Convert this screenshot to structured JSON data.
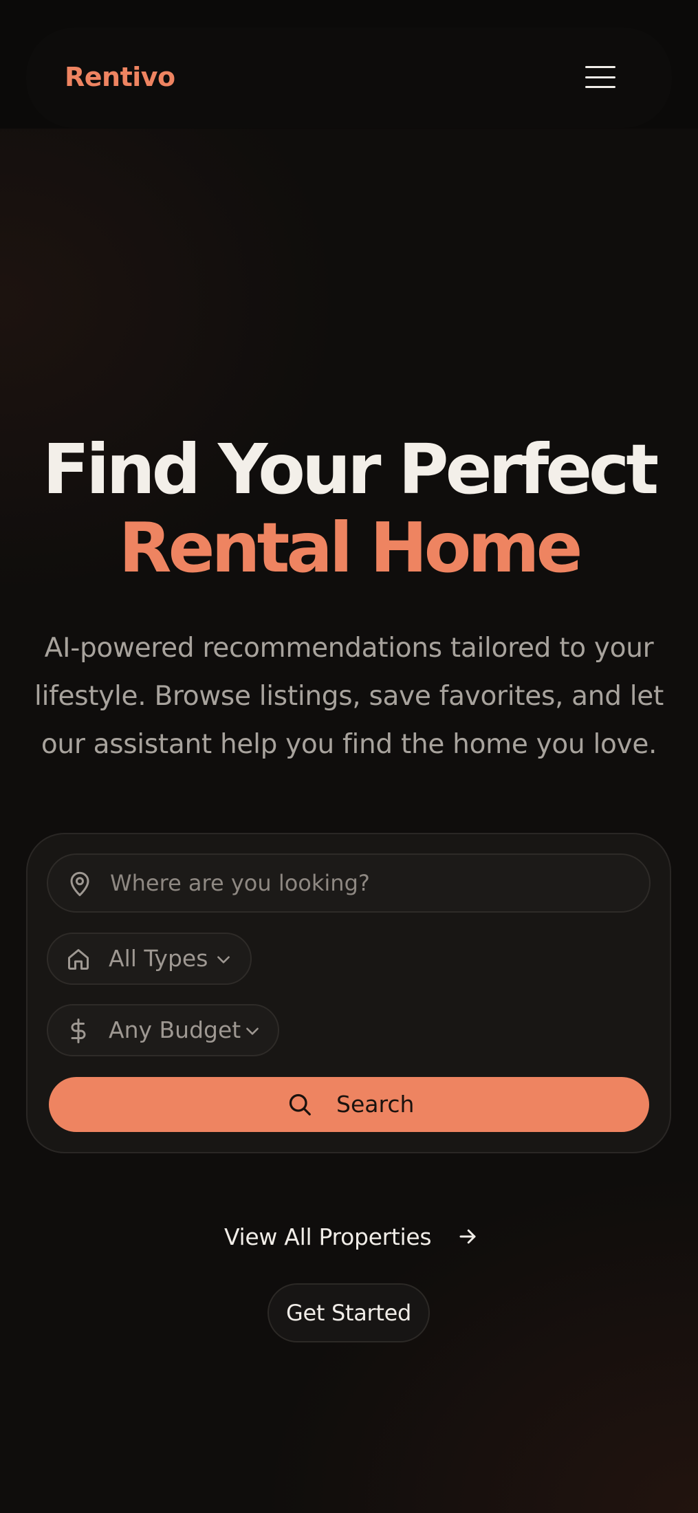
{
  "header": {
    "logo": "Rentivo",
    "menu_icon": "hamburger-menu-icon"
  },
  "hero": {
    "title_line1": "Find Your Perfect",
    "title_line2": "Rental Home",
    "subtitle": "AI-powered recommendations tailored to your lifestyle. Browse listings, save favorites, and let our assistant help you find the home you love."
  },
  "search": {
    "location_placeholder": "Where are you looking?",
    "location_icon": "map-pin-icon",
    "type_filter": {
      "label": "All Types",
      "icon": "home-icon"
    },
    "budget_filter": {
      "label": "Any Budget",
      "icon": "dollar-icon"
    },
    "button_label": "Search",
    "button_icon": "search-icon"
  },
  "actions": {
    "view_all_label": "View All Properties",
    "view_all_icon": "arrow-right-icon",
    "get_started_label": "Get Started"
  },
  "colors": {
    "accent": "#ee8461",
    "background": "#0f0d0c",
    "text_primary": "#f3efe9",
    "text_muted": "#a8a39d"
  }
}
